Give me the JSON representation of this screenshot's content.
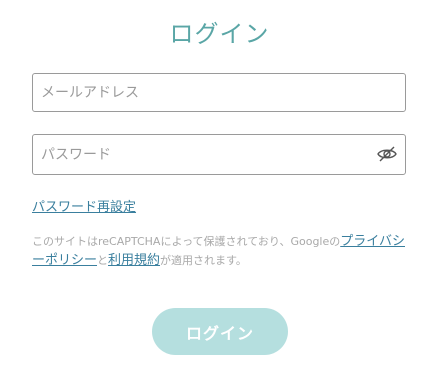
{
  "page": {
    "title": "ログイン"
  },
  "form": {
    "email": {
      "placeholder": "メールアドレス",
      "value": ""
    },
    "password": {
      "placeholder": "パスワード",
      "value": "",
      "toggle_icon": "eye-slash-icon"
    },
    "forgot_link": "パスワード再設定",
    "notice": {
      "prefix": "このサイトはreCAPTCHAによって保護されており、Googleの",
      "privacy_link": "プライバシーポリシー",
      "connector": "と",
      "terms_link": "利用規約",
      "suffix": "が適用されます。"
    },
    "submit_label": "ログイン"
  },
  "colors": {
    "title": "#5aa6a6",
    "link": "#3a7f9e",
    "button_bg": "#b5dfdf",
    "border": "#9a9a9a",
    "muted_text": "#a9a9a9"
  }
}
